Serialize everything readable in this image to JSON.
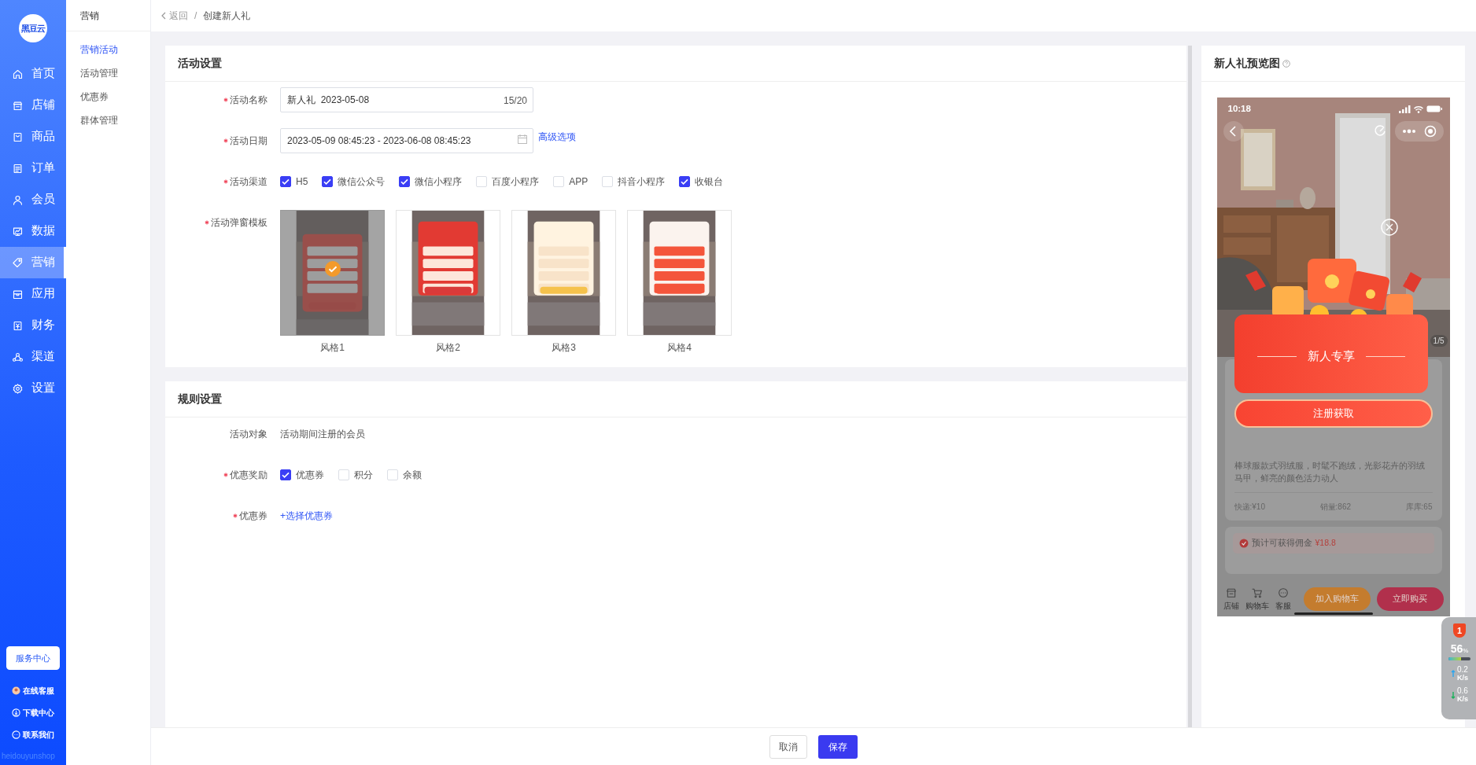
{
  "sidebar": {
    "logo": "黑豆云",
    "items": [
      {
        "label": "首页",
        "selected": false
      },
      {
        "label": "店铺",
        "selected": false
      },
      {
        "label": "商品",
        "selected": false
      },
      {
        "label": "订单",
        "selected": false
      },
      {
        "label": "会员",
        "selected": false
      },
      {
        "label": "数据",
        "selected": false
      },
      {
        "label": "营销",
        "selected": true
      },
      {
        "label": "应用",
        "selected": false
      },
      {
        "label": "财务",
        "selected": false
      },
      {
        "label": "渠道",
        "selected": false
      },
      {
        "label": "设置",
        "selected": false
      }
    ],
    "service_button": "服务中心",
    "links": [
      "在线客服",
      "下载中心",
      "联系我们"
    ],
    "footer": "heidouyunshop"
  },
  "submenu": {
    "title": "营销",
    "items": [
      {
        "label": "营销活动",
        "selected": true
      },
      {
        "label": "活动管理",
        "selected": false
      },
      {
        "label": "优惠券",
        "selected": false
      },
      {
        "label": "群体管理",
        "selected": false
      }
    ]
  },
  "breadcrumb": {
    "back": "返回",
    "separator": "/",
    "current": "创建新人礼"
  },
  "activity_settings": {
    "title": "活动设置",
    "name": {
      "label": "活动名称",
      "required": true,
      "value": "新人礼  2023-05-08",
      "counter": "15/20"
    },
    "date": {
      "label": "活动日期",
      "required": true,
      "value": "2023-05-09 08:45:23 - 2023-06-08 08:45:23",
      "link": "高级选项"
    },
    "channels": {
      "label": "活动渠道",
      "required": true,
      "options": [
        {
          "label": "H5",
          "checked": true
        },
        {
          "label": "微信公众号",
          "checked": true
        },
        {
          "label": "微信小程序",
          "checked": true
        },
        {
          "label": "百度小程序",
          "checked": false
        },
        {
          "label": "APP",
          "checked": false
        },
        {
          "label": "抖音小程序",
          "checked": false
        },
        {
          "label": "收银台",
          "checked": true
        }
      ]
    },
    "templates": {
      "label": "活动弹窗模板",
      "required": true,
      "options": [
        {
          "label": "风格1",
          "selected": true
        },
        {
          "label": "风格2",
          "selected": false
        },
        {
          "label": "风格3",
          "selected": false
        },
        {
          "label": "风格4",
          "selected": false
        }
      ]
    }
  },
  "rule_settings": {
    "title": "规则设置",
    "target": {
      "label": "活动对象",
      "value": "活动期间注册的会员"
    },
    "reward": {
      "label": "优惠奖励",
      "required": true,
      "options": [
        {
          "label": "优惠券",
          "checked": true
        },
        {
          "label": "积分",
          "checked": false
        },
        {
          "label": "余额",
          "checked": false
        }
      ]
    },
    "coupon": {
      "label": "优惠券",
      "required": true,
      "link": "+选择优惠券"
    }
  },
  "preview": {
    "title": "新人礼预览图",
    "phone": {
      "time": "10:18",
      "image_counter": "1/5",
      "banner": "新人专享",
      "cta": "注册获取",
      "description": "棒球服款式羽绒服，时髦不跑绒，光影花卉的羽绒马甲，鲜亮的颜色活力动人",
      "stats": [
        "快递:¥10",
        "销量:862",
        "库库:65"
      ],
      "commission_label": "预计可获得佣金",
      "commission_value": "¥18.8",
      "tabs": [
        "店铺",
        "购物车",
        "客服"
      ],
      "buttons": [
        {
          "label": "加入购物车",
          "kind": "cart"
        },
        {
          "label": "立即购买",
          "kind": "buy"
        }
      ]
    }
  },
  "footer": {
    "cancel": "取消",
    "save": "保存"
  },
  "monitor": {
    "alerts": "1",
    "percent": "56",
    "percent_unit": "%",
    "level": 0.56,
    "upload": "0.2",
    "upload_unit": "K/s",
    "download": "0.6",
    "download_unit": "K/s"
  }
}
